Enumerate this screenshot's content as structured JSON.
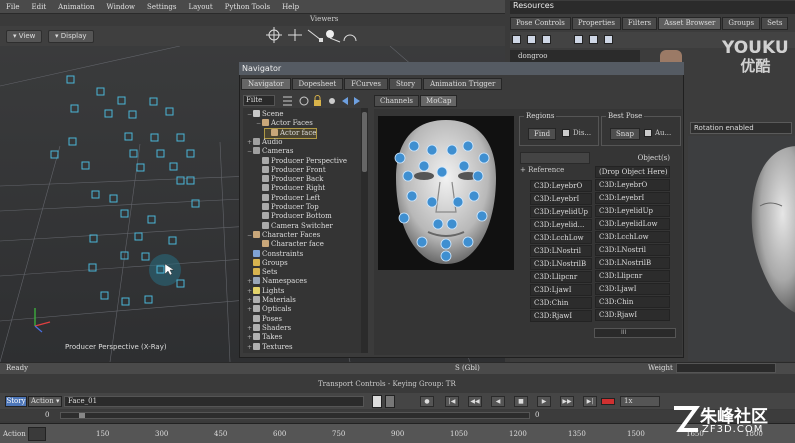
{
  "menubar": {
    "items": [
      "File",
      "Edit",
      "Animation",
      "Window",
      "Settings",
      "Layout",
      "Python Tools",
      "Help"
    ]
  },
  "viewer": {
    "title": "Viewers",
    "view_label": "View",
    "display_label": "Display",
    "caption": "Producer Perspective (X-Ray)"
  },
  "resources": {
    "title": "Resources",
    "tabs": [
      "Pose Controls",
      "Properties",
      "Filters",
      "Asset Browser",
      "Groups",
      "Sets"
    ],
    "active_tab": "Asset Browser",
    "list_item": "dongroo"
  },
  "watermark": {
    "line1": "YOUKU",
    "line2": "优酷"
  },
  "navigator": {
    "title": "Navigator",
    "tabs": [
      "Navigator",
      "Dopesheet",
      "FCurves",
      "Story",
      "Animation Trigger"
    ],
    "active_tab": "Navigator",
    "filter_label": "Filte",
    "tree": [
      {
        "label": "Scene",
        "depth": 0,
        "toggle": "−",
        "color": "#c9c9c9"
      },
      {
        "label": "Actor Faces",
        "depth": 1,
        "toggle": "−",
        "color": "#c9a77a"
      },
      {
        "label": "Actor face",
        "depth": 2,
        "toggle": "",
        "color": "#c9a77a",
        "selected": true
      },
      {
        "label": "Audio",
        "depth": 0,
        "toggle": "+",
        "color": "#a0a0a0"
      },
      {
        "label": "Cameras",
        "depth": 0,
        "toggle": "−",
        "color": "#a0a0a0"
      },
      {
        "label": "Producer Perspective",
        "depth": 1,
        "toggle": "",
        "color": "#aaaaaa"
      },
      {
        "label": "Producer Front",
        "depth": 1,
        "toggle": "",
        "color": "#aaaaaa"
      },
      {
        "label": "Producer Back",
        "depth": 1,
        "toggle": "",
        "color": "#aaaaaa"
      },
      {
        "label": "Producer Right",
        "depth": 1,
        "toggle": "",
        "color": "#aaaaaa"
      },
      {
        "label": "Producer Left",
        "depth": 1,
        "toggle": "",
        "color": "#aaaaaa"
      },
      {
        "label": "Producer Top",
        "depth": 1,
        "toggle": "",
        "color": "#aaaaaa"
      },
      {
        "label": "Producer Bottom",
        "depth": 1,
        "toggle": "",
        "color": "#aaaaaa"
      },
      {
        "label": "Camera Switcher",
        "depth": 1,
        "toggle": "",
        "color": "#aaaaaa"
      },
      {
        "label": "Character Faces",
        "depth": 0,
        "toggle": "−",
        "color": "#c9a77a"
      },
      {
        "label": "Character face",
        "depth": 1,
        "toggle": "",
        "color": "#c9a77a"
      },
      {
        "label": "Constraints",
        "depth": 0,
        "toggle": "",
        "color": "#7fa2d4"
      },
      {
        "label": "Groups",
        "depth": 0,
        "toggle": "",
        "color": "#d7b34f"
      },
      {
        "label": "Sets",
        "depth": 0,
        "toggle": "",
        "color": "#d7b34f"
      },
      {
        "label": "Namespaces",
        "depth": 0,
        "toggle": "+",
        "color": "#9aa7b8"
      },
      {
        "label": "Lights",
        "depth": 0,
        "toggle": "+",
        "color": "#e3d36a"
      },
      {
        "label": "Materials",
        "depth": 0,
        "toggle": "+",
        "color": "#b0b0b0"
      },
      {
        "label": "Opticals",
        "depth": 0,
        "toggle": "+",
        "color": "#b0b0b0"
      },
      {
        "label": "Poses",
        "depth": 0,
        "toggle": "",
        "color": "#b0b0b0"
      },
      {
        "label": "Shaders",
        "depth": 0,
        "toggle": "+",
        "color": "#b0b0b0"
      },
      {
        "label": "Takes",
        "depth": 0,
        "toggle": "+",
        "color": "#b0b0b0"
      },
      {
        "label": "Textures",
        "depth": 0,
        "toggle": "+",
        "color": "#b0b0b0"
      }
    ],
    "sub_tabs": [
      "Channels",
      "MoCap"
    ],
    "active_sub_tab": "MoCap",
    "regions": {
      "label": "Regions",
      "find": "Find",
      "dis": "Dis..."
    },
    "best_pose": {
      "label": "Best Pose",
      "snap": "Snap",
      "auto": "Au..."
    },
    "object_header": "Object(s)",
    "reference_label": "Reference",
    "left_rows": [
      "C3D:LeyebrO",
      "C3D:LeyebrI",
      "C3D:LeyelidUp",
      "C3D:Leyelid...",
      "C3D:LcchLow",
      "C3D:LNostril",
      "C3D:LNostrilB",
      "C3D:Llipcnr",
      "C3D:LjawI",
      "C3D:Chin",
      "C3D:RjawI"
    ],
    "right_rows": [
      "(Drop Object Here)",
      "C3D:LeyebrO",
      "C3D:LeyebrI",
      "C3D:LeyelidUp",
      "C3D:LeyelidLow",
      "C3D:LcchLow",
      "C3D:LNostril",
      "C3D:LNostrilB",
      "C3D:Llipcnr",
      "C3D:LjawI",
      "C3D:Chin",
      "C3D:RjawI"
    ],
    "bottom_scroll_label": "III",
    "rotation_label": "Rotation enabled"
  },
  "status": {
    "text": "Ready",
    "group_label": "S (Gbl)",
    "weight_label": "Weight"
  },
  "transport": {
    "label": "Transport Controls  -  Keying Group: TR",
    "story_label": "Story",
    "action_label": "Action",
    "take_value": "Face_01",
    "speed_value": "1x",
    "zoom_start": "0",
    "zoom_end": "0"
  },
  "ruler": {
    "label": "Action",
    "ticks": [
      "150",
      "300",
      "450",
      "600",
      "750",
      "900",
      "1050",
      "1200",
      "1350",
      "1500",
      "1650",
      "1800"
    ]
  },
  "logo": {
    "line1": "朱峰社区",
    "line2": "ZF3D.COM"
  },
  "colors": {
    "marker": "#4ab6d8",
    "grid": "#6a6b6d",
    "accent": "#4d76b8"
  }
}
